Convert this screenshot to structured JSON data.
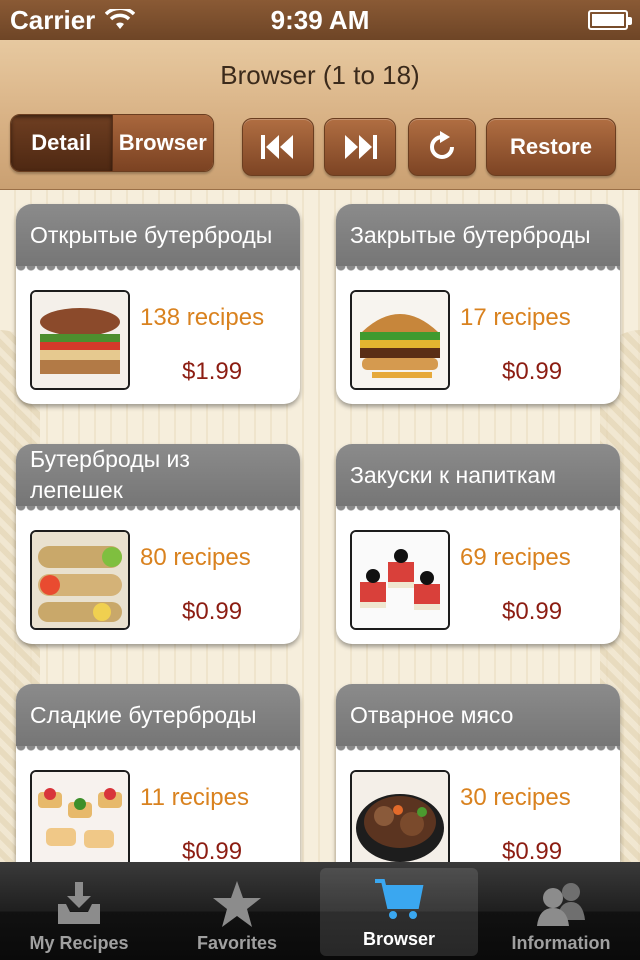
{
  "status_bar": {
    "carrier": "Carrier",
    "time": "9:39 AM"
  },
  "header": {
    "title": "Browser (1 to 18)",
    "segments": [
      "Detail",
      "Browser"
    ],
    "active_segment": "Browser",
    "restore_label": "Restore"
  },
  "categories": [
    {
      "title": "Открытые бутерброды",
      "count": "138 recipes",
      "price": "$1.99"
    },
    {
      "title": "Закрытые бутерброды",
      "count": "17 recipes",
      "price": "$0.99"
    },
    {
      "title": "Бутерброды из лепешек",
      "count": "80 recipes",
      "price": "$0.99"
    },
    {
      "title": "Закуски к напиткам",
      "count": "69 recipes",
      "price": "$0.99"
    },
    {
      "title": "Сладкие бутерброды",
      "count": "11 recipes",
      "price": "$0.99"
    },
    {
      "title": "Отварное мясо",
      "count": "30 recipes",
      "price": "$0.99"
    }
  ],
  "tab_bar": {
    "tabs": [
      "My Recipes",
      "Favorites",
      "Browser",
      "Information"
    ],
    "active": "Browser"
  },
  "colors": {
    "accent_brown": "#7b4222",
    "recipe_count": "#d9821f",
    "price": "#8c1d12",
    "card_title_bar": "#808080"
  }
}
